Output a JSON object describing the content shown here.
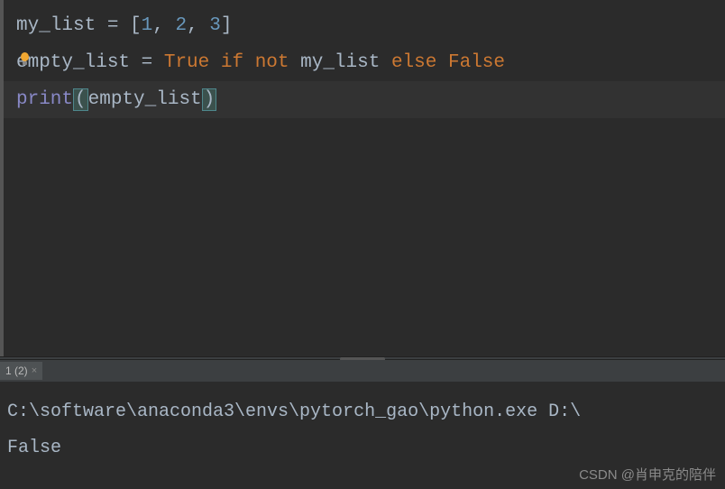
{
  "editor": {
    "line1": {
      "v1": "my_list",
      "eq": " = ",
      "lb": "[",
      "n1": "1",
      "c1": ", ",
      "n2": "2",
      "c2": ", ",
      "n3": "3",
      "rb": "]"
    },
    "line2": {
      "v1": "empty_list",
      "eq": " = ",
      "kw_true": "True",
      "sp1": " ",
      "kw_if": "if",
      "sp2": " ",
      "kw_not": "not",
      "sp3": " ",
      "v2": "my_list",
      "sp4": " ",
      "kw_else": "else",
      "sp5": " ",
      "kw_false": "False"
    },
    "line3": {
      "fn": "print",
      "lp": "(",
      "arg": "empty_list",
      "rp": ")"
    }
  },
  "console": {
    "tab_label": "1 (2)",
    "out_line1": "C:\\software\\anaconda3\\envs\\pytorch_gao\\python.exe D:\\",
    "out_line2": "False"
  },
  "watermark": "CSDN @肖申克的陪伴",
  "colors": {
    "bg": "#2b2b2b",
    "text": "#a9b7c6",
    "number": "#6897bb",
    "keyword": "#cc7832",
    "builtin": "#8888c6"
  }
}
